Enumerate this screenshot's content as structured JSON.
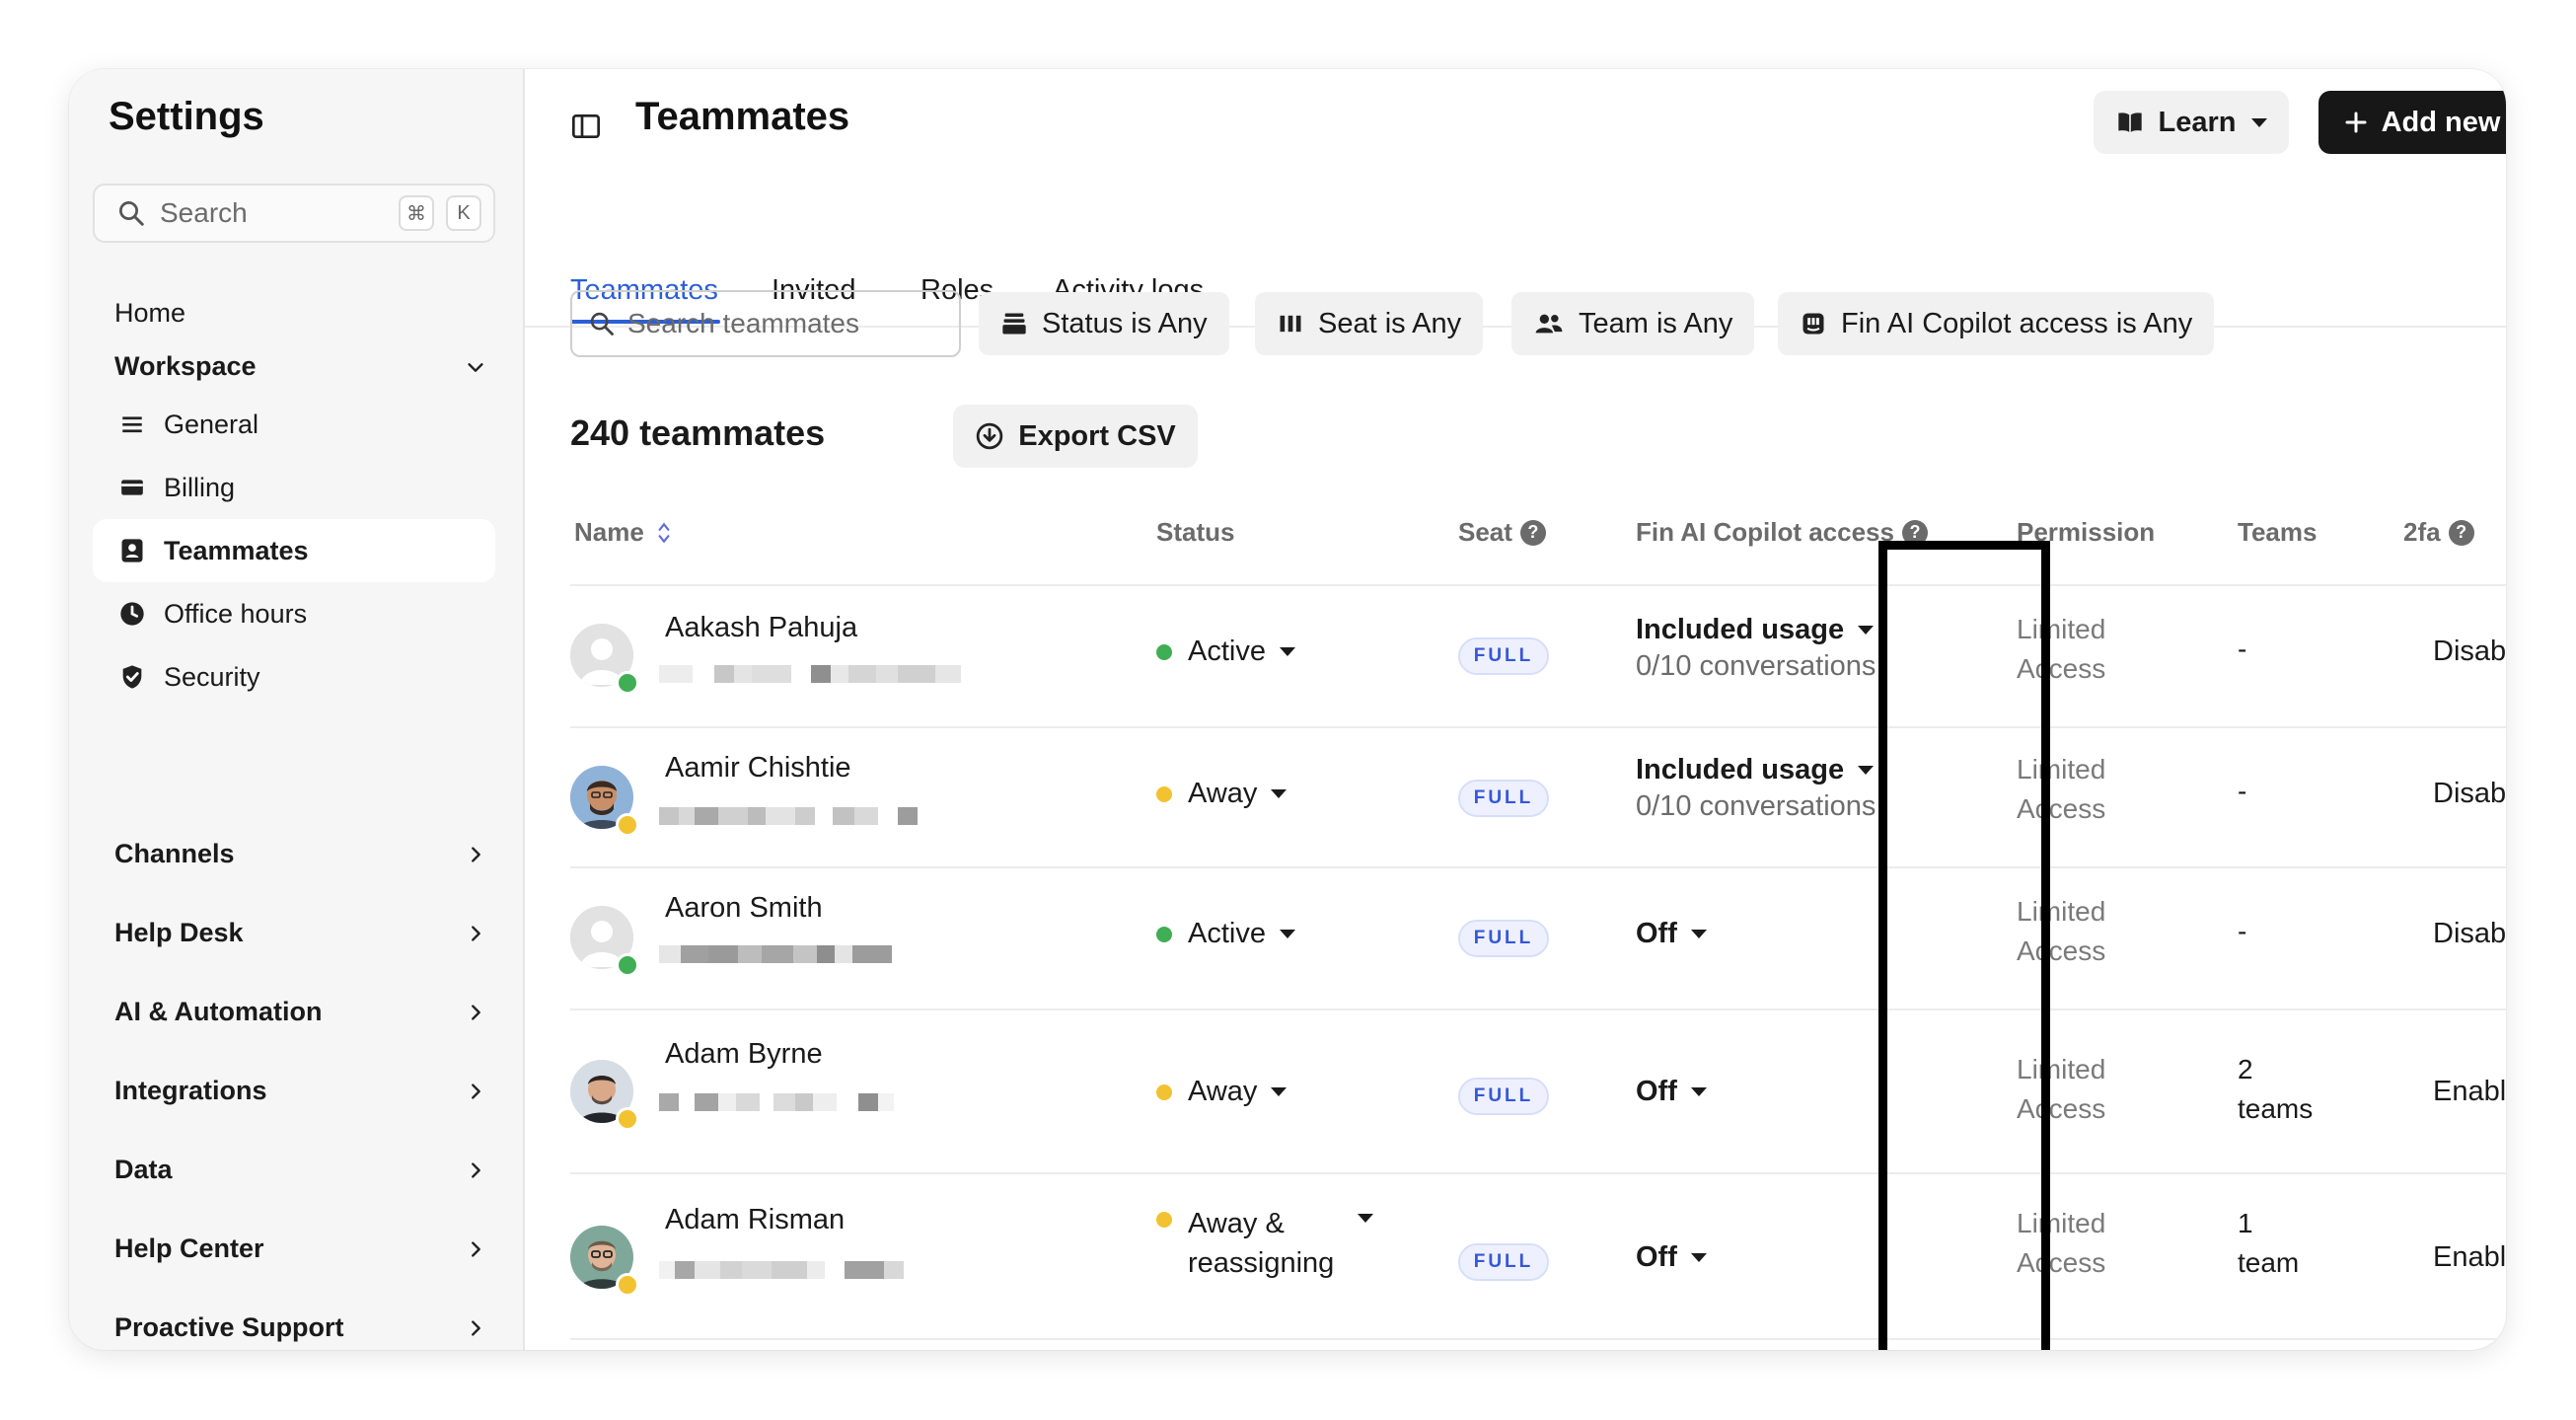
{
  "sidebar": {
    "title": "Settings",
    "search": {
      "placeholder": "Search",
      "shortcut_mod": "⌘",
      "shortcut_key": "K"
    },
    "home": "Home",
    "workspace": {
      "label": "Workspace",
      "items": [
        {
          "label": "General",
          "icon": "list-icon"
        },
        {
          "label": "Billing",
          "icon": "card-icon"
        },
        {
          "label": "Teammates",
          "icon": "person-badge-icon",
          "active": true
        },
        {
          "label": "Office hours",
          "icon": "clock-icon"
        },
        {
          "label": "Security",
          "icon": "shield-icon"
        }
      ]
    },
    "groups": [
      "Channels",
      "Help Desk",
      "AI & Automation",
      "Integrations",
      "Data",
      "Help Center",
      "Proactive Support"
    ]
  },
  "header": {
    "title": "Teammates",
    "learn_label": "Learn",
    "add_label": "Add new"
  },
  "tabs": [
    "Teammates",
    "Invited",
    "Roles",
    "Activity logs"
  ],
  "filters": {
    "search_placeholder": "Search teammates",
    "status": "Status is Any",
    "seat": "Seat is Any",
    "team": "Team is Any",
    "copilot": "Fin AI Copilot access is Any"
  },
  "summary": {
    "count_label": "240 teammates",
    "export_label": "Export CSV"
  },
  "columns": {
    "name": "Name",
    "status": "Status",
    "seat": "Seat",
    "copilot": "Fin AI Copilot access",
    "permission": "Permission",
    "teams": "Teams",
    "twofa": "2fa"
  },
  "rows": [
    {
      "name": "Aakash Pahuja",
      "status": "Active",
      "seat": "FULL",
      "copilot": "Included usage",
      "copilot_sub": "0/10 conversations",
      "perm1": "Limited",
      "perm2": "Access",
      "teams1": "-",
      "teams2": "",
      "twofa": "Disabled"
    },
    {
      "name": "Aamir Chishtie",
      "status": "Away",
      "seat": "FULL",
      "copilot": "Included usage",
      "copilot_sub": "0/10 conversations",
      "perm1": "Limited",
      "perm2": "Access",
      "teams1": "-",
      "teams2": "",
      "twofa": "Disabled"
    },
    {
      "name": "Aaron Smith",
      "status": "Active",
      "seat": "FULL",
      "copilot": "Off",
      "copilot_sub": "",
      "perm1": "Limited",
      "perm2": "Access",
      "teams1": "-",
      "teams2": "",
      "twofa": "Disabled"
    },
    {
      "name": "Adam Byrne",
      "status": "Away",
      "seat": "FULL",
      "copilot": "Off",
      "copilot_sub": "",
      "perm1": "Limited",
      "perm2": "Access",
      "teams1": "2",
      "teams2": "teams",
      "twofa": "Enabled"
    },
    {
      "name": "Adam Risman",
      "status": "Away &",
      "status2": "reassigning",
      "seat": "FULL",
      "copilot": "Off",
      "copilot_sub": "",
      "perm1": "Limited",
      "perm2": "Access",
      "teams1": "1",
      "teams2": "team",
      "twofa": "Enabled"
    }
  ],
  "colors": {
    "accent": "#2c5fd6",
    "active": "#3fae55",
    "away": "#f2c230",
    "seat_badge": "#3557d9"
  }
}
